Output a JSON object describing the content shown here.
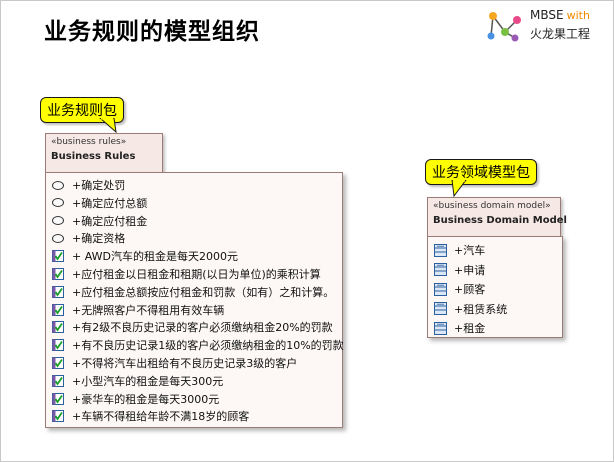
{
  "title": "业务规则的模型组织",
  "logo": {
    "line1": "MBSE",
    "with": "with",
    "line2": "火龙果工程"
  },
  "callouts": {
    "rules": "业务规则包",
    "domain": "业务领域模型包"
  },
  "rules_package": {
    "stereotype": "«business rules»",
    "name": "Business Rules",
    "items": [
      {
        "icon": "oval",
        "label": "+确定处罚"
      },
      {
        "icon": "oval",
        "label": "+确定应付总额"
      },
      {
        "icon": "oval",
        "label": "+确定应付租金"
      },
      {
        "icon": "oval",
        "label": "+确定资格"
      },
      {
        "icon": "check",
        "label": "+ AWD汽车的租金是每天2000元"
      },
      {
        "icon": "check",
        "label": "+应付租金以日租金和租期(以日为单位)的乘积计算"
      },
      {
        "icon": "check",
        "label": "+应付租金总额按应付租金和罚款（如有）之和计算。"
      },
      {
        "icon": "check",
        "label": "+无牌照客户不得租用有效车辆"
      },
      {
        "icon": "check",
        "label": "+有2级不良历史记录的客户必须缴纳租金20%的罚款"
      },
      {
        "icon": "check",
        "label": "+有不良历史记录1级的客户必须缴纳租金的10%的罚款"
      },
      {
        "icon": "check",
        "label": "+不得将汽车出租给有不良历史记录3级的客户"
      },
      {
        "icon": "check",
        "label": "+小型汽车的租金是每天300元"
      },
      {
        "icon": "check",
        "label": "+豪华车的租金是每天3000元"
      },
      {
        "icon": "check",
        "label": "+车辆不得租给年龄不满18岁的顾客"
      }
    ]
  },
  "domain_package": {
    "stereotype": "«business domain model»",
    "name": "Business Domain Model",
    "items": [
      {
        "icon": "class",
        "label": "+汽车"
      },
      {
        "icon": "class",
        "label": "+申请"
      },
      {
        "icon": "class",
        "label": "+顾客"
      },
      {
        "icon": "class",
        "label": "+租赁系统"
      },
      {
        "icon": "class",
        "label": "+租金"
      }
    ]
  }
}
